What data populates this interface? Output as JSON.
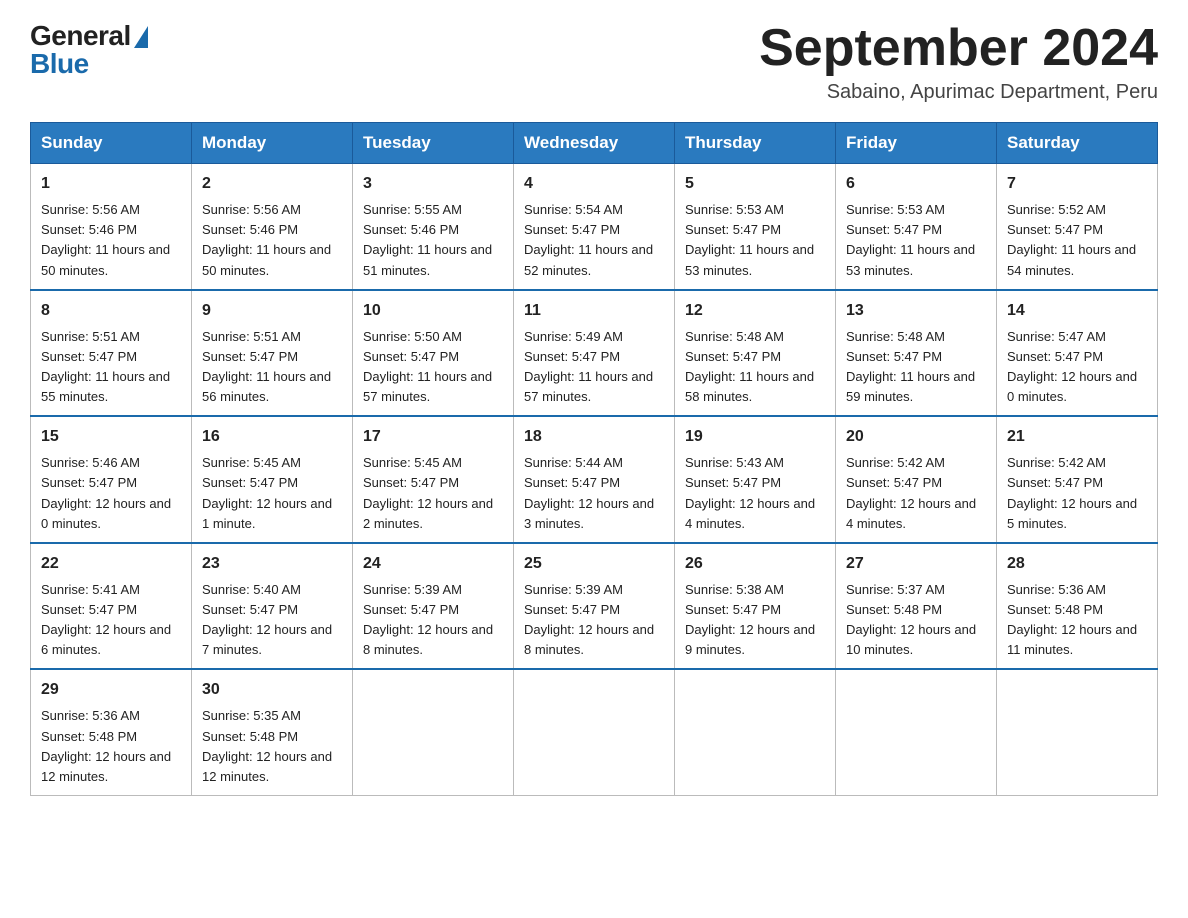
{
  "logo": {
    "general": "General",
    "blue": "Blue"
  },
  "header": {
    "month": "September 2024",
    "location": "Sabaino, Apurimac Department, Peru"
  },
  "weekdays": [
    "Sunday",
    "Monday",
    "Tuesday",
    "Wednesday",
    "Thursday",
    "Friday",
    "Saturday"
  ],
  "weeks": [
    [
      {
        "day": "1",
        "sunrise": "5:56 AM",
        "sunset": "5:46 PM",
        "daylight": "11 hours and 50 minutes."
      },
      {
        "day": "2",
        "sunrise": "5:56 AM",
        "sunset": "5:46 PM",
        "daylight": "11 hours and 50 minutes."
      },
      {
        "day": "3",
        "sunrise": "5:55 AM",
        "sunset": "5:46 PM",
        "daylight": "11 hours and 51 minutes."
      },
      {
        "day": "4",
        "sunrise": "5:54 AM",
        "sunset": "5:47 PM",
        "daylight": "11 hours and 52 minutes."
      },
      {
        "day": "5",
        "sunrise": "5:53 AM",
        "sunset": "5:47 PM",
        "daylight": "11 hours and 53 minutes."
      },
      {
        "day": "6",
        "sunrise": "5:53 AM",
        "sunset": "5:47 PM",
        "daylight": "11 hours and 53 minutes."
      },
      {
        "day": "7",
        "sunrise": "5:52 AM",
        "sunset": "5:47 PM",
        "daylight": "11 hours and 54 minutes."
      }
    ],
    [
      {
        "day": "8",
        "sunrise": "5:51 AM",
        "sunset": "5:47 PM",
        "daylight": "11 hours and 55 minutes."
      },
      {
        "day": "9",
        "sunrise": "5:51 AM",
        "sunset": "5:47 PM",
        "daylight": "11 hours and 56 minutes."
      },
      {
        "day": "10",
        "sunrise": "5:50 AM",
        "sunset": "5:47 PM",
        "daylight": "11 hours and 57 minutes."
      },
      {
        "day": "11",
        "sunrise": "5:49 AM",
        "sunset": "5:47 PM",
        "daylight": "11 hours and 57 minutes."
      },
      {
        "day": "12",
        "sunrise": "5:48 AM",
        "sunset": "5:47 PM",
        "daylight": "11 hours and 58 minutes."
      },
      {
        "day": "13",
        "sunrise": "5:48 AM",
        "sunset": "5:47 PM",
        "daylight": "11 hours and 59 minutes."
      },
      {
        "day": "14",
        "sunrise": "5:47 AM",
        "sunset": "5:47 PM",
        "daylight": "12 hours and 0 minutes."
      }
    ],
    [
      {
        "day": "15",
        "sunrise": "5:46 AM",
        "sunset": "5:47 PM",
        "daylight": "12 hours and 0 minutes."
      },
      {
        "day": "16",
        "sunrise": "5:45 AM",
        "sunset": "5:47 PM",
        "daylight": "12 hours and 1 minute."
      },
      {
        "day": "17",
        "sunrise": "5:45 AM",
        "sunset": "5:47 PM",
        "daylight": "12 hours and 2 minutes."
      },
      {
        "day": "18",
        "sunrise": "5:44 AM",
        "sunset": "5:47 PM",
        "daylight": "12 hours and 3 minutes."
      },
      {
        "day": "19",
        "sunrise": "5:43 AM",
        "sunset": "5:47 PM",
        "daylight": "12 hours and 4 minutes."
      },
      {
        "day": "20",
        "sunrise": "5:42 AM",
        "sunset": "5:47 PM",
        "daylight": "12 hours and 4 minutes."
      },
      {
        "day": "21",
        "sunrise": "5:42 AM",
        "sunset": "5:47 PM",
        "daylight": "12 hours and 5 minutes."
      }
    ],
    [
      {
        "day": "22",
        "sunrise": "5:41 AM",
        "sunset": "5:47 PM",
        "daylight": "12 hours and 6 minutes."
      },
      {
        "day": "23",
        "sunrise": "5:40 AM",
        "sunset": "5:47 PM",
        "daylight": "12 hours and 7 minutes."
      },
      {
        "day": "24",
        "sunrise": "5:39 AM",
        "sunset": "5:47 PM",
        "daylight": "12 hours and 8 minutes."
      },
      {
        "day": "25",
        "sunrise": "5:39 AM",
        "sunset": "5:47 PM",
        "daylight": "12 hours and 8 minutes."
      },
      {
        "day": "26",
        "sunrise": "5:38 AM",
        "sunset": "5:47 PM",
        "daylight": "12 hours and 9 minutes."
      },
      {
        "day": "27",
        "sunrise": "5:37 AM",
        "sunset": "5:48 PM",
        "daylight": "12 hours and 10 minutes."
      },
      {
        "day": "28",
        "sunrise": "5:36 AM",
        "sunset": "5:48 PM",
        "daylight": "12 hours and 11 minutes."
      }
    ],
    [
      {
        "day": "29",
        "sunrise": "5:36 AM",
        "sunset": "5:48 PM",
        "daylight": "12 hours and 12 minutes."
      },
      {
        "day": "30",
        "sunrise": "5:35 AM",
        "sunset": "5:48 PM",
        "daylight": "12 hours and 12 minutes."
      },
      null,
      null,
      null,
      null,
      null
    ]
  ]
}
